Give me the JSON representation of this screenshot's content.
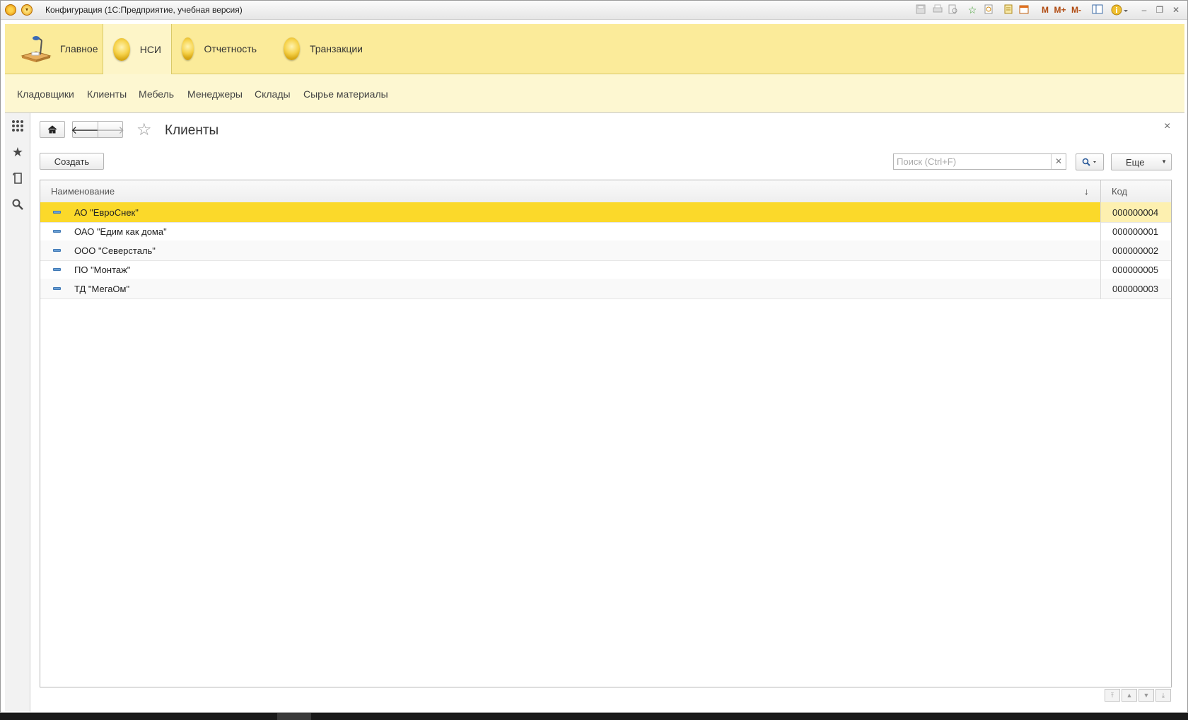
{
  "window": {
    "title": "Конфигурация  (1С:Предприятие, учебная версия)",
    "toolbar_icons": [
      "save-icon",
      "print-icon",
      "preview-icon",
      "favorite-add-icon",
      "history-icon",
      "calculator-icon",
      "calendar-icon",
      "m-icon",
      "m-plus-icon",
      "m-minus-icon",
      "panels-icon",
      "info-icon",
      "minimize-icon",
      "restore-icon",
      "close-icon"
    ],
    "mem_labels": {
      "m": "M",
      "mplus": "M+",
      "mminus": "M-"
    }
  },
  "sections": [
    {
      "label": "Главное",
      "icon": "desk-lamp-icon",
      "active": false
    },
    {
      "label": "НСИ",
      "icon": "section-icon",
      "active": true
    },
    {
      "label": "Отчетность",
      "icon": "section-icon",
      "active": false
    },
    {
      "label": "Транзакции",
      "icon": "section-icon",
      "active": false
    }
  ],
  "functions": [
    "Кладовщики",
    "Клиенты",
    "Мебель",
    "Менеджеры",
    "Склады",
    "Сырье материалы"
  ],
  "left_tools": [
    "apps-grid-icon",
    "star-icon",
    "history-icon",
    "search-icon"
  ],
  "form": {
    "title": "Клиенты",
    "create_label": "Создать",
    "search_placeholder": "Поиск (Ctrl+F)",
    "more_label": "Еще",
    "close": "×"
  },
  "table": {
    "columns": [
      "Наименование",
      "Код"
    ],
    "sort_indicator": "↓",
    "rows": [
      {
        "name": "АО \"ЕвроСнек\"",
        "code": "000000004",
        "selected": true
      },
      {
        "name": "ОАО \"Едим как дома\"",
        "code": "000000001",
        "selected": false
      },
      {
        "name": "ООО \"Северсталь\"",
        "code": "000000002",
        "selected": false
      },
      {
        "name": "ПО \"Монтаж\"",
        "code": "000000005",
        "selected": false
      },
      {
        "name": "ТД \"МегаОм\"",
        "code": "000000003",
        "selected": false
      }
    ]
  },
  "colors": {
    "sections_bg": "#fbeb9a",
    "functions_bg": "#fdf7d1",
    "selected_row": "#fbd92a"
  }
}
